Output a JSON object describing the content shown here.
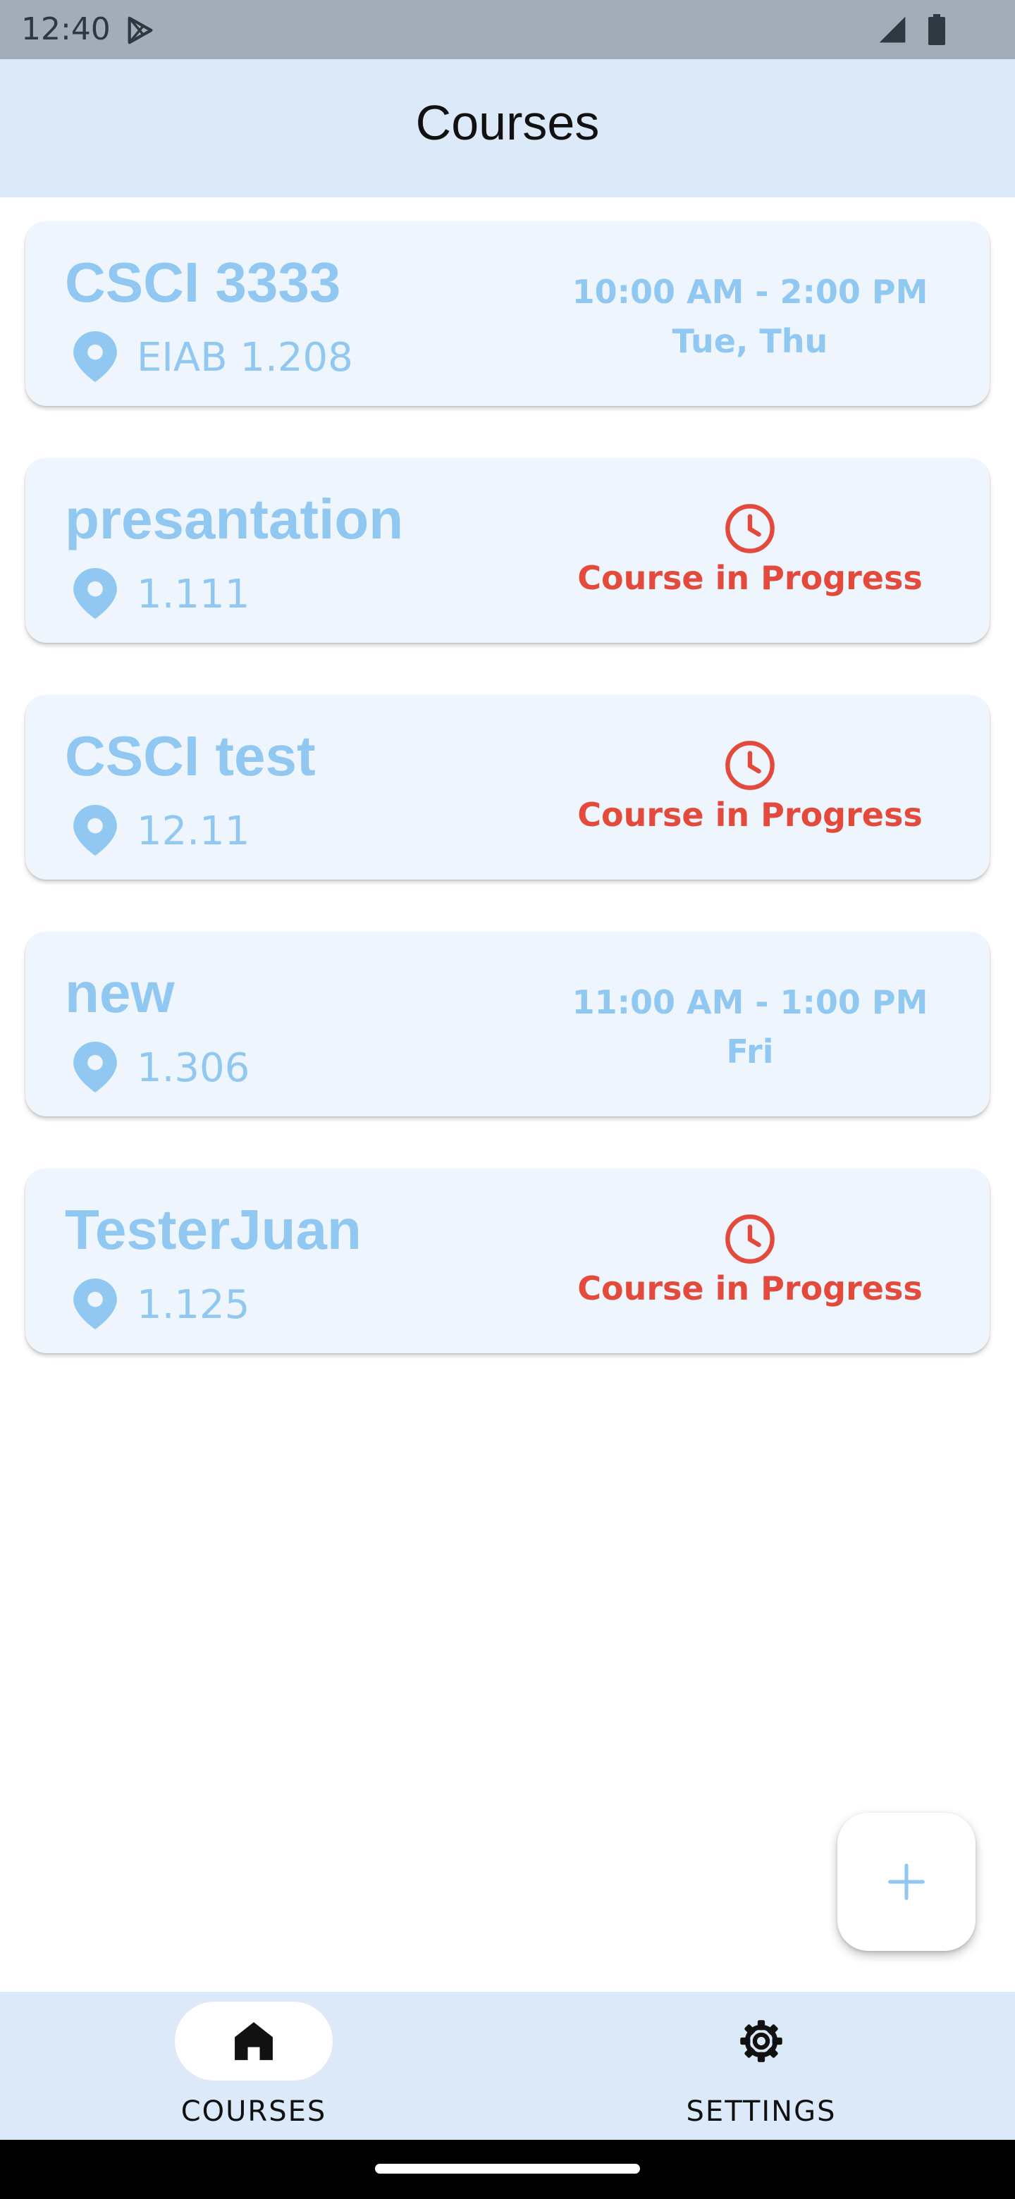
{
  "status_bar": {
    "time": "12:40",
    "icons": [
      "play-store-icon",
      "signal-icon",
      "battery-icon"
    ]
  },
  "app_bar": {
    "title": "Courses"
  },
  "courses": [
    {
      "name": "CSCI 3333",
      "room": "EIAB 1.208",
      "status": "schedule",
      "time_range": "10:00 AM - 2:00 PM",
      "days": "Tue, Thu"
    },
    {
      "name": "presantation",
      "room": "1.111",
      "status": "in-progress",
      "progress_label": "Course in Progress"
    },
    {
      "name": "CSCI test",
      "room": "12.11",
      "status": "in-progress",
      "progress_label": "Course in Progress"
    },
    {
      "name": "new",
      "room": "1.306",
      "status": "schedule",
      "time_range": "11:00 AM - 1:00 PM",
      "days": "Fri"
    },
    {
      "name": "TesterJuan",
      "room": "1.125",
      "status": "in-progress",
      "progress_label": "Course in Progress"
    }
  ],
  "fab": {
    "icon": "plus-icon"
  },
  "bottom_nav": {
    "items": [
      {
        "label": "COURSES",
        "icon": "home-icon",
        "selected": true
      },
      {
        "label": "SETTINGS",
        "icon": "gear-icon",
        "selected": false
      }
    ]
  },
  "colors": {
    "accent": "#90c8f2",
    "in_progress": "#e34a3b",
    "app_bar_bg": "#dbe9f8",
    "card_bg": "#eef5fd"
  }
}
